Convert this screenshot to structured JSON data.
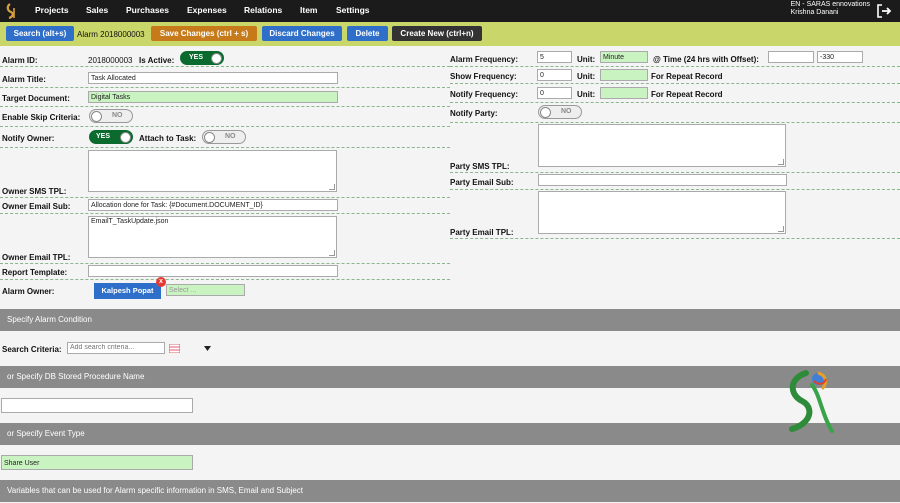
{
  "nav": {
    "items": [
      "Projects",
      "Sales",
      "Purchases",
      "Expenses",
      "Relations",
      "Item",
      "Settings"
    ],
    "org": "EN - SARAS ennovations",
    "user": "Krishna Danani"
  },
  "toolbar": {
    "search": "Search (alt+s)",
    "alarm_prefix": "Alarm",
    "alarm_no": "2018000003",
    "save": "Save Changes (ctrl + s)",
    "discard": "Discard Changes",
    "delete": "Delete",
    "create": "Create New (ctrl+n)"
  },
  "left": {
    "alarm_id_label": "Alarm ID:",
    "alarm_id": "2018000003",
    "is_active_label": "Is Active:",
    "is_active": "YES",
    "title_label": "Alarm Title:",
    "title": "Task Allocated",
    "target_label": "Target Document:",
    "target": "Digital Tasks",
    "skip_label": "Enable Skip Criteria:",
    "skip": "NO",
    "notify_owner_label": "Notify Owner:",
    "notify_owner": "YES",
    "attach_label": "Attach to Task:",
    "attach": "NO",
    "sms_tpl_label": "Owner SMS TPL:",
    "email_sub_label": "Owner Email Sub:",
    "email_sub": "Allocation done for Task: {#Document.DOCUMENT_ID}",
    "email_tpl_label": "Owner Email TPL:",
    "email_tpl": "EmailT_TaskUpdate.json",
    "report_label": "Report Template:",
    "owner_label": "Alarm Owner:",
    "owner_chip": "Kalpesh Popat",
    "owner_placeholder": "Select ..."
  },
  "right": {
    "freq_label": "Alarm Frequency:",
    "freq": "5",
    "unit_label": "Unit:",
    "freq_unit": "Minute",
    "time_label": "@ Time (24 hrs with Offset):",
    "time_offset": "-330",
    "show_label": "Show Frequency:",
    "show": "0",
    "repeat_label": "For Repeat Record",
    "notify_freq_label": "Notify Frequency:",
    "notify_freq": "0",
    "notify_party_label": "Notify Party:",
    "notify_party": "NO",
    "party_sms_label": "Party SMS TPL:",
    "party_email_sub_label": "Party Email Sub:",
    "party_email_tpl_label": "Party Email TPL:"
  },
  "sections": {
    "condition": "Specify Alarm Condition",
    "search_label": "Search Criteria:",
    "search_placeholder": "Add search criteria...",
    "proc": "or Specify DB Stored Procedure Name",
    "event": "or Specify Event Type",
    "event_value": "Share User",
    "vars": "Variables that can be used for Alarm specific information in SMS, Email and Subject"
  },
  "colors": {
    "nav": "#1b1b1b",
    "toolbar": "#c9d76a",
    "primary": "#2f6fc9",
    "save": "#c77a1a",
    "toggle_on": "#0b6b2e",
    "section": "#8a8a8a",
    "field_green": "#c9f3c0"
  }
}
